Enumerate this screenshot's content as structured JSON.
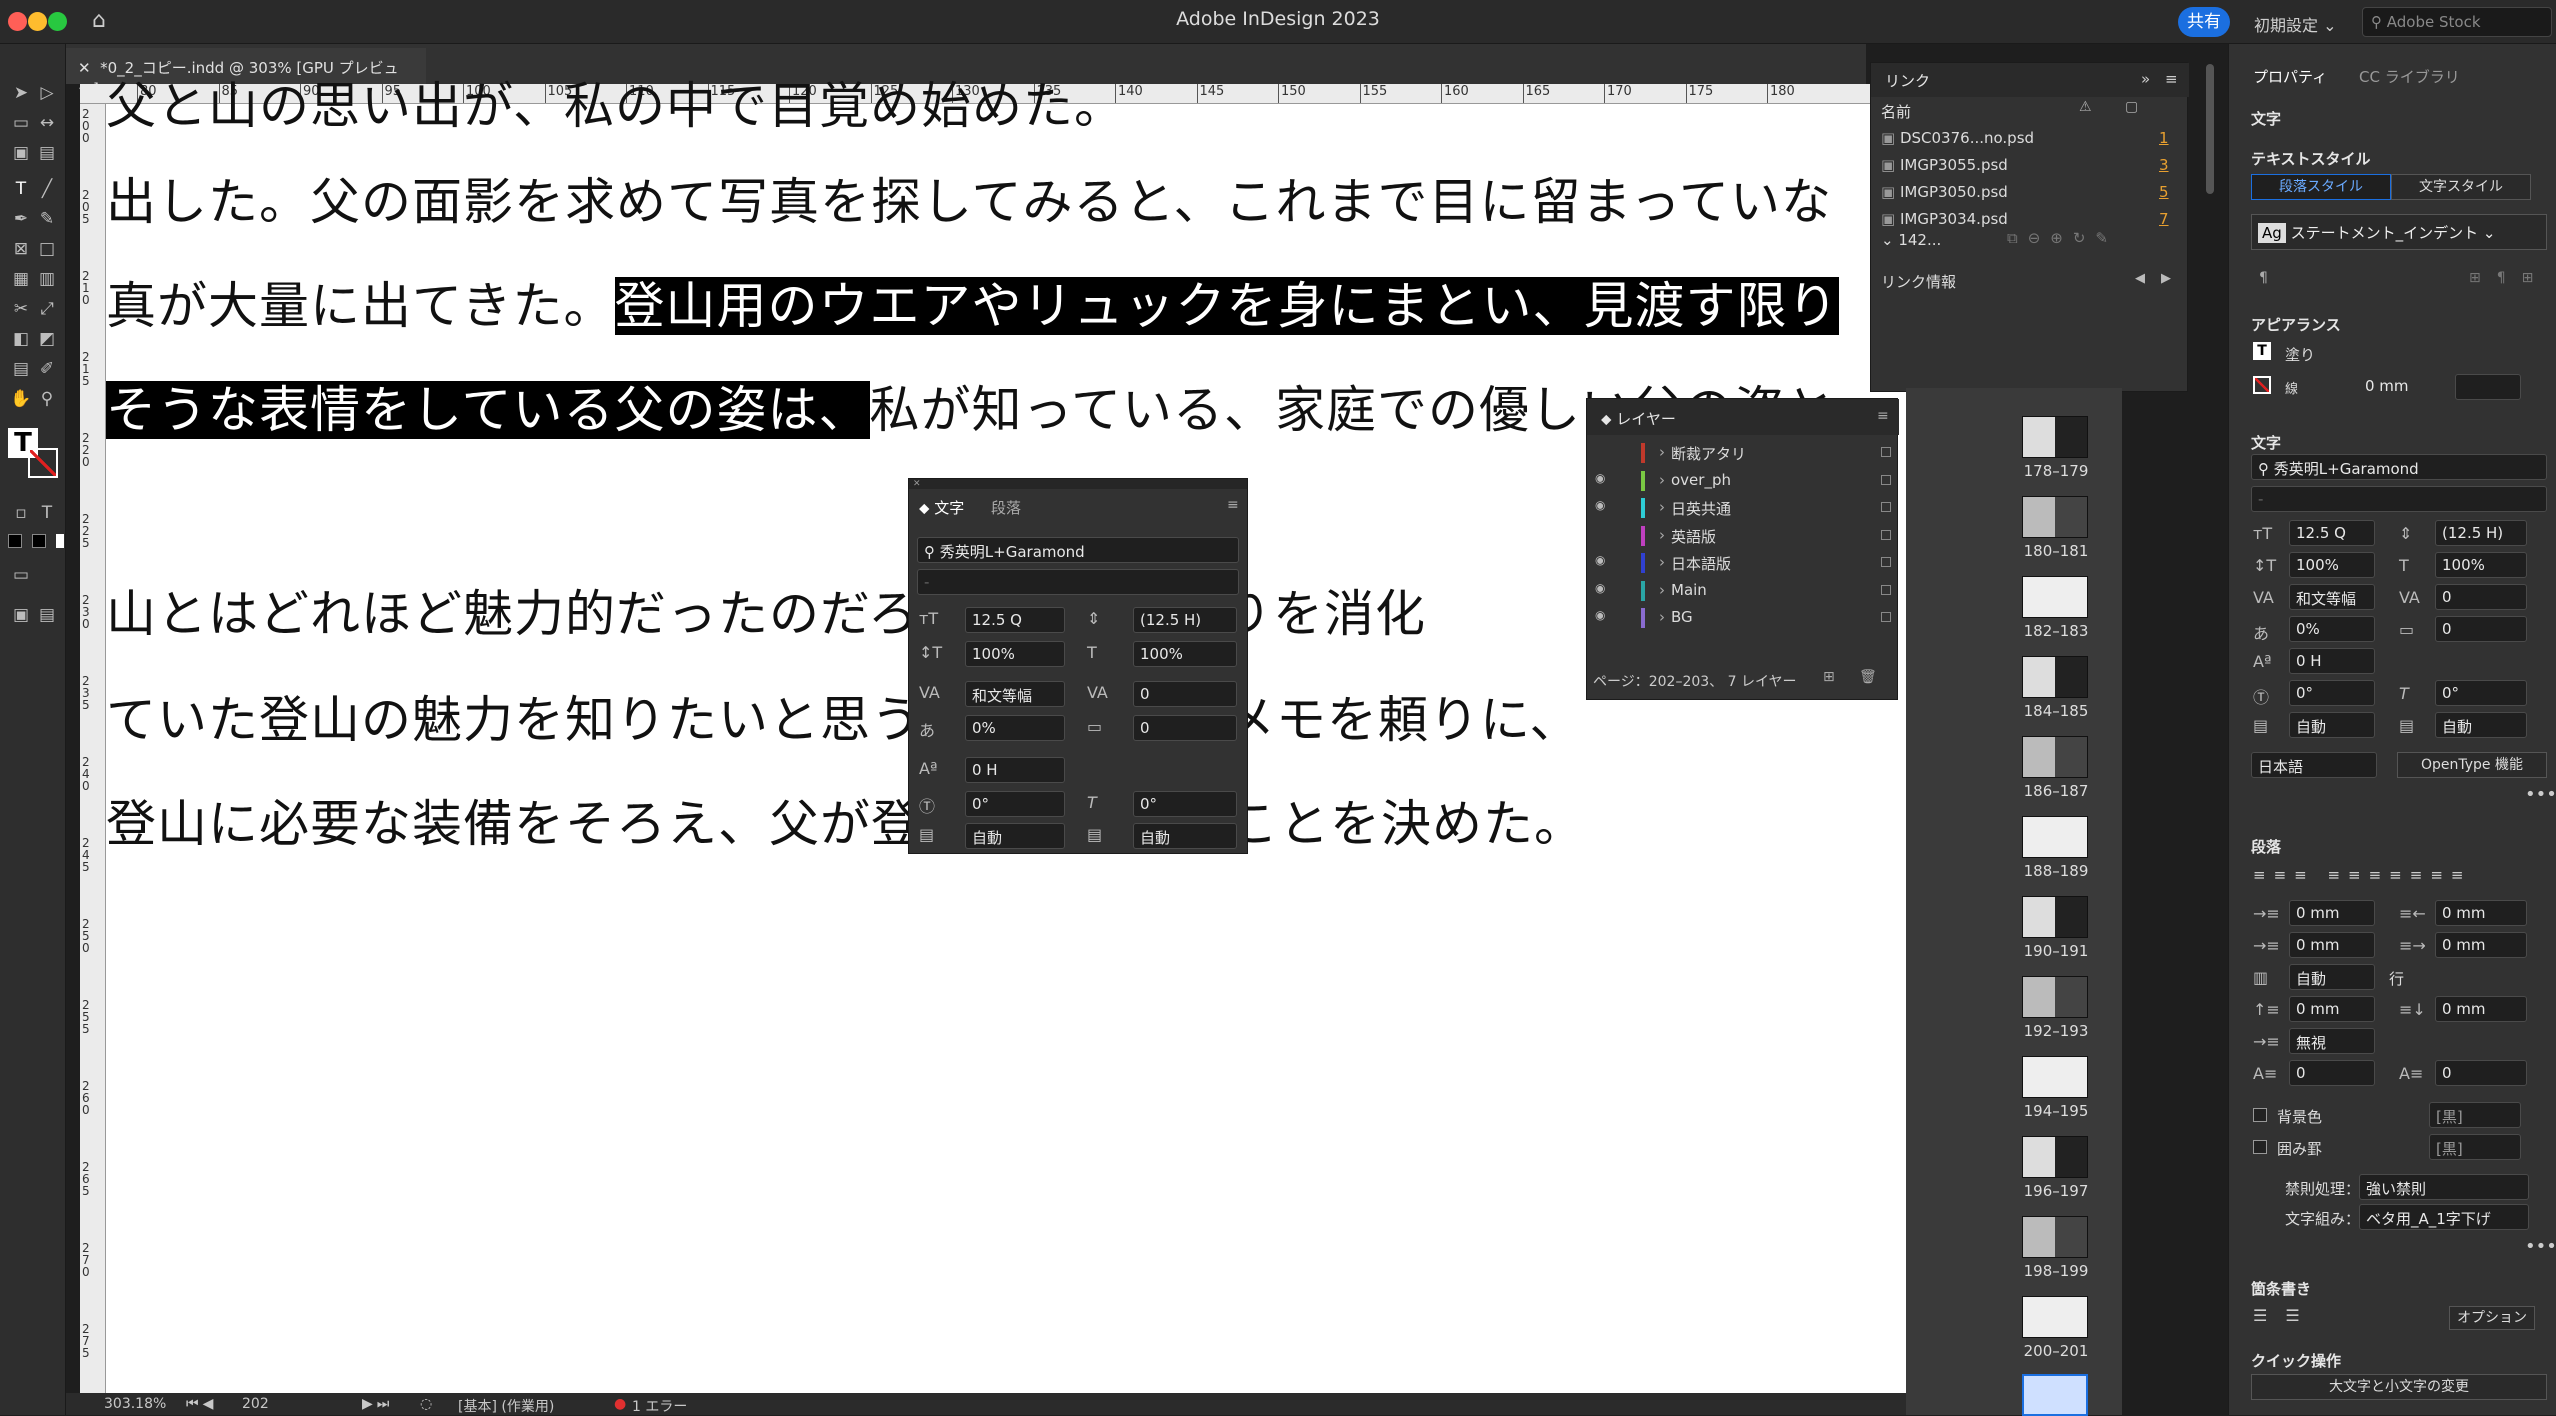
{
  "app": {
    "title": "Adobe InDesign 2023",
    "share": "共有",
    "workspace": "初期設定",
    "stock_search": "Adobe Stock"
  },
  "doc": {
    "tab_label": "*0_2_コピー.indd @ 303% [GPU プレビュー]"
  },
  "ruler": {
    "h": [
      "80",
      "85",
      "90",
      "95",
      "100",
      "105",
      "110",
      "115",
      "120",
      "125",
      "130",
      "135",
      "140",
      "145",
      "150",
      "155",
      "160",
      "165",
      "170",
      "175",
      "180"
    ],
    "v": [
      "200",
      "205",
      "210",
      "215",
      "220",
      "225",
      "230",
      "235",
      "240",
      "245",
      "250",
      "255",
      "260",
      "265",
      "270",
      "275"
    ]
  },
  "text": {
    "l1": "父と山の思い出が、私の中で目覚め始めた。",
    "l2": "出した。父の面影を求めて写真を探してみると、これまで目に留まっていな",
    "l3a": "真が大量に出てきた。",
    "l3b": "登山用のウエアやリュックを身にまとい、見渡す限り",
    "l4a": "そうな表情をしている父の姿は、",
    "l4b": "私が知っている、家庭での優しい父の姿と",
    "l5": "山とはどれほど魅力的だったのだろう。生じた憤りを消化",
    "l6": "ていた登山の魅力を知りたいと思う。父の遺したメモを頼りに、",
    "l7": "登山に必要な装備をそろえ、父が登った山へ行くことを決めた。"
  },
  "status": {
    "zoom": "303.18%",
    "page": "202",
    "style": "[基本] (作業用)",
    "errors": "1 エラー"
  },
  "links_panel": {
    "title": "リンク",
    "col_name": "名前",
    "items": [
      {
        "name": "DSC0376...no.psd",
        "page": "1"
      },
      {
        "name": "IMGP3055.psd",
        "page": "3"
      },
      {
        "name": "IMGP3050.psd",
        "page": "5"
      },
      {
        "name": "IMGP3034.psd",
        "page": "7"
      }
    ],
    "count": "142...",
    "info": "リンク情報"
  },
  "layers_panel": {
    "title": "レイヤー",
    "layers": [
      {
        "name": "断裁アタリ",
        "color": "#c0392b",
        "visible": false
      },
      {
        "name": "over_ph",
        "color": "#7ac943",
        "visible": true
      },
      {
        "name": "日英共通",
        "color": "#2ecdd6",
        "visible": true
      },
      {
        "name": "英語版",
        "color": "#c040c0",
        "visible": false
      },
      {
        "name": "日本語版",
        "color": "#3040d0",
        "visible": true
      },
      {
        "name": "Main",
        "color": "#2aa6a6",
        "visible": true
      },
      {
        "name": "BG",
        "color": "#8a6cd0",
        "visible": true
      }
    ],
    "footer": "ページ：202–203、 7 レイヤー"
  },
  "char_panel": {
    "tab_char": "文字",
    "tab_para": "段落",
    "font": "秀英明L+Garamond",
    "size": "12.5 Q",
    "leading": "(12.5 H)",
    "vscale": "100%",
    "hscale": "100%",
    "kerning": "和文等幅",
    "tracking": "0",
    "tsume": "0%",
    "aki": "0",
    "baseline": "0 H",
    "rotate": "0°",
    "skew": "0°",
    "auto1": "自動",
    "auto2": "自動"
  },
  "pages_panel": {
    "labels": [
      "178–179",
      "180–181",
      "182–183",
      "184–185",
      "186–187",
      "188–189",
      "190–191",
      "192–193",
      "194–195",
      "196–197",
      "198–199",
      "200–201"
    ]
  },
  "properties": {
    "tab1": "プロパティ",
    "tab2": "CC ライブラリ",
    "sec_text": "文字",
    "sec_textstyle": "テキストスタイル",
    "para_style": "段落スタイル",
    "char_style": "文字スタイル",
    "style_name": "ステートメント_インデント",
    "sec_appearance": "アピアランス",
    "fill": "塗り",
    "stroke": "線",
    "stroke_w": "0 mm",
    "sec_char": "文字",
    "font": "秀英明L+Garamond",
    "size": "12.5 Q",
    "leading": "(12.5 H)",
    "vscale": "100%",
    "hscale": "100%",
    "kerning": "和文等幅",
    "tracking": "0",
    "tsume": "0%",
    "aki": "0",
    "baseline": "0 H",
    "rotate": "0°",
    "skew": "0°",
    "auto1": "自動",
    "auto2": "自動",
    "lang": "日本語",
    "opentype": "OpenType 機能",
    "sec_para": "段落",
    "indent_l": "0 mm",
    "indent_r": "0 mm",
    "first": "0 mm",
    "last": "0 mm",
    "grid": "自動",
    "grid_unit": "行",
    "space_b": "0 mm",
    "space_a": "0 mm",
    "ignore": "無視",
    "dropcap_l": "0",
    "dropcap_c": "0",
    "bg_color": "背景色",
    "frame": "囲み罫",
    "swatch": "[黒]",
    "kinsoku_label": "禁則処理：",
    "kinsoku": "強い禁則",
    "mojikumi_label": "文字組み：",
    "mojikumi": "ベタ用_A_1字下げ",
    "sec_bullets": "箇条書き",
    "options": "オプション",
    "sec_quick": "クイック操作",
    "quick_btn": "大文字と小文字の変更"
  },
  "colors": {
    "accent": "#1b6fe0",
    "selection": "#000000",
    "error": "#e03030"
  }
}
